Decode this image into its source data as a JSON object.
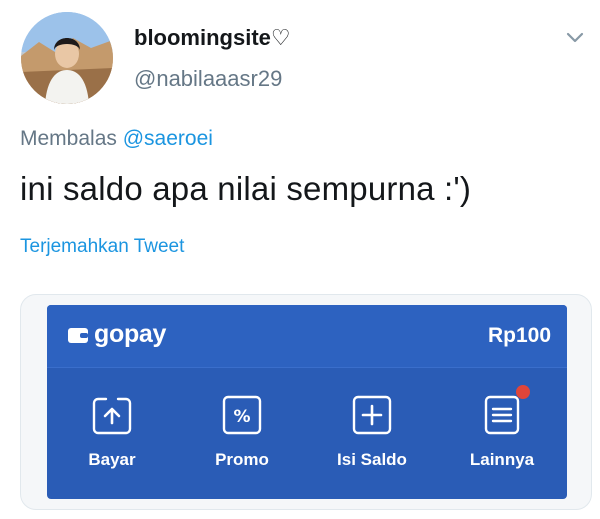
{
  "user": {
    "display_name": "bloomingsite♡",
    "handle": "@nabilaaasr29"
  },
  "reply": {
    "prefix": "Membalas",
    "mention": "@saeroei"
  },
  "tweet": {
    "text": "ini saldo apa nilai sempurna :')",
    "translate_label": "Terjemahkan Tweet"
  },
  "gopay": {
    "brand": "gopay",
    "balance": "Rp100",
    "actions": [
      {
        "label": "Bayar",
        "icon": "pay-arrow-up-icon"
      },
      {
        "label": "Promo",
        "icon": "percent-icon"
      },
      {
        "label": "Isi Saldo",
        "icon": "plus-icon"
      },
      {
        "label": "Lainnya",
        "icon": "list-icon",
        "badge": true
      }
    ],
    "colors": {
      "panel": "#2a5cb6",
      "badge": "#e0453a"
    }
  }
}
